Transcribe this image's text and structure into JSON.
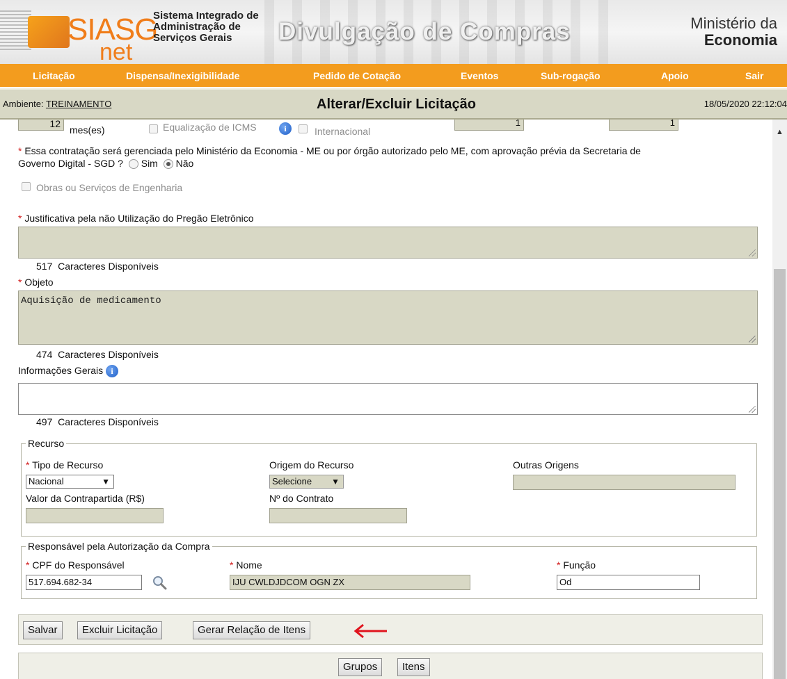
{
  "banner": {
    "logo_siasg": "SIASG",
    "logo_net": "net",
    "system_title_line1": "Sistema Integrado de",
    "system_title_line2": "Administração de",
    "system_title_line3": "Serviços Gerais",
    "main_title": "Divulgação de Compras",
    "ministry_line1": "Ministério da",
    "ministry_line2": "Economia"
  },
  "menu": {
    "items": [
      "Licitação",
      "Dispensa/Inexigibilidade",
      "Pedido de Cotação",
      "Eventos",
      "Sub-rogação",
      "Apoio",
      "Sair"
    ]
  },
  "titlebar": {
    "env_prefix": "Ambiente:",
    "env_value": "TREINAMENTO",
    "page_title": "Alterar/Excluir Licitação",
    "datetime": "18/05/2020 22:12:04"
  },
  "top_row": {
    "months_value": "12",
    "months_unit": "mes(es)",
    "icms_label": "Equalização de ICMS",
    "international_label": "Internacional",
    "field1_value": "1",
    "field2_value": "1"
  },
  "management_question": {
    "text": "Essa contratação será gerenciada pelo Ministério da Economia - ME ou por órgão autorizado pelo ME, com aprovação prévia da Secretaria de Governo Digital - SGD ?",
    "text_line1": "Essa contratação será gerenciada pelo Ministério da Economia - ME ou por órgão autorizado pelo ME, com aprovação prévia da Secretaria de",
    "text_line2": "Governo Digital - SGD ?",
    "option_yes": "Sim",
    "option_no": "Não",
    "selected": "Não"
  },
  "engineering_label": "Obras ou Serviços de Engenharia",
  "justification": {
    "label": "Justificativa pela não Utilização do Pregão Eletrônico",
    "value": "",
    "remaining": "517",
    "remaining_label": "Caracteres Disponíveis"
  },
  "object": {
    "label": "Objeto",
    "value": "Aquisição de medicamento",
    "remaining": "474",
    "remaining_label": "Caracteres Disponíveis"
  },
  "general_info": {
    "label": "Informações Gerais",
    "value": "",
    "remaining": "497",
    "remaining_label": "Caracteres Disponíveis"
  },
  "resource": {
    "legend": "Recurso",
    "type_label": "Tipo de Recurso",
    "type_value": "Nacional",
    "origin_label": "Origem do Recurso",
    "origin_value": "Selecione",
    "other_origins_label": "Outras Origens",
    "counterpart_label": "Valor da Contrapartida (R$)",
    "contract_label": "Nº do Contrato"
  },
  "responsible": {
    "legend": "Responsável pela Autorização da Compra",
    "cpf_label": "CPF do Responsável",
    "cpf_value": "517.694.682-34",
    "name_label": "Nome",
    "name_value": "IJU CWLDJDCOM OGN ZX",
    "role_label": "Função",
    "role_value": "Od"
  },
  "actions": {
    "save": "Salvar",
    "delete": "Excluir Licitação",
    "generate": "Gerar Relação de Itens"
  },
  "bottom_tabs": {
    "groups": "Grupos",
    "items": "Itens"
  },
  "colors": {
    "menu_orange": "#f39c1e",
    "field_gray": "#d8d8c5",
    "required_red": "#d21a1a",
    "arrow_red": "#e0141e"
  }
}
